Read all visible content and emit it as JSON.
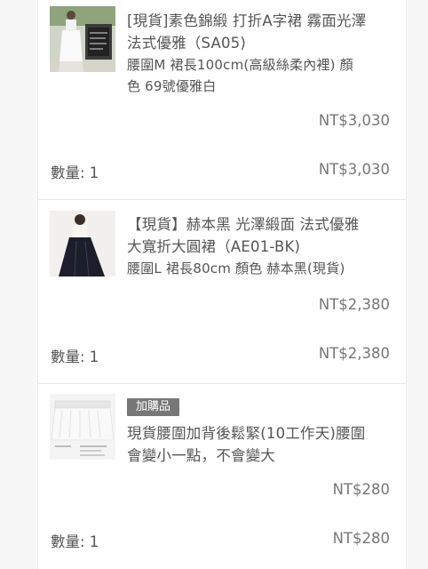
{
  "cart": {
    "items": [
      {
        "title": "[現貨]素色錦緞 打折A字裙 霧面光澤 法式優雅（SA05)",
        "variant": "腰圍M 裙長100cm(高級絲柔內裡) 顏色 69號優雅白",
        "unit_price": "NT$3,030",
        "qty_label": "數量: 1",
        "subtotal": "NT$3,030"
      },
      {
        "title": "【現貨】赫本黑 光澤緞面 法式優雅大寬折大圓裙（AE01-BK)",
        "variant": "腰圍L 裙長80cm 顏色 赫本黑(現貨)",
        "unit_price": "NT$2,380",
        "qty_label": "數量: 1",
        "subtotal": "NT$2,380"
      },
      {
        "badge": "加購品",
        "title": "現貨腰圍加背後鬆緊(10工作天)腰圍會變小一點，不會變大",
        "unit_price": "NT$280",
        "qty_label": "數量: 1",
        "subtotal": "NT$280"
      }
    ]
  },
  "colors": {
    "text": "#555555",
    "price": "#777777",
    "badge_bg": "#777777",
    "divider": "#e8e8e8"
  }
}
